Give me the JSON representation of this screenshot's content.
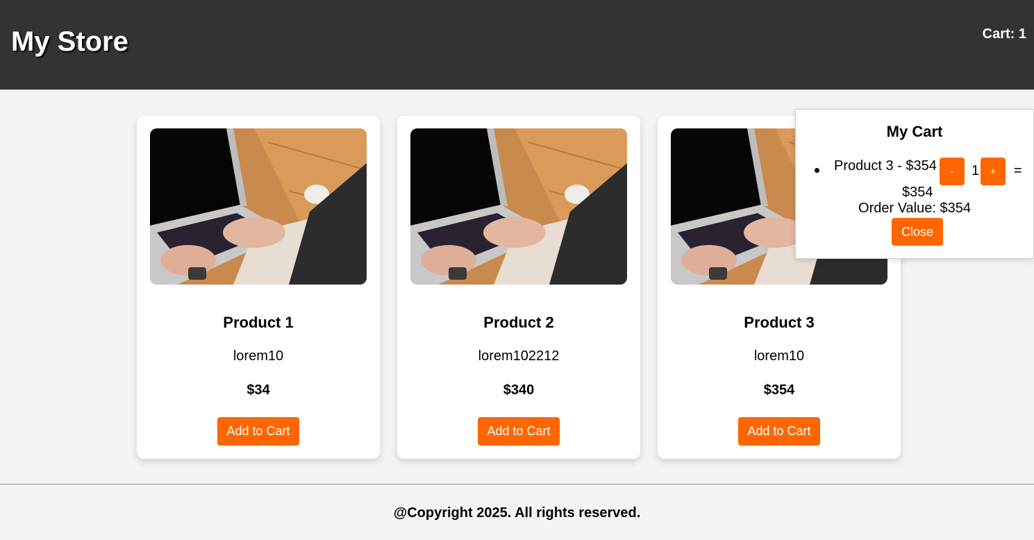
{
  "header": {
    "title": "My Store",
    "cart_label": "Cart: 1"
  },
  "products": [
    {
      "name": "Product 1",
      "description": "lorem10",
      "price": "$34",
      "button_label": "Add to Cart",
      "image_icon": "laptop-typing-photo"
    },
    {
      "name": "Product 2",
      "description": "lorem102212",
      "price": "$340",
      "button_label": "Add to Cart",
      "image_icon": "laptop-typing-photo"
    },
    {
      "name": "Product 3",
      "description": "lorem10",
      "price": "$354",
      "button_label": "Add to Cart",
      "image_icon": "laptop-typing-photo"
    }
  ],
  "cart": {
    "title": "My Cart",
    "items": [
      {
        "label": "Product 3 - $354",
        "decrement_label": "-",
        "quantity": "1",
        "increment_label": "+",
        "equals": "=",
        "subtotal": "$354"
      }
    ],
    "order_value": "Order Value: $354",
    "close_label": "Close"
  },
  "footer": {
    "copyright": "@Copyright 2025. All rights reserved."
  },
  "colors": {
    "header_bg": "#333333",
    "accent": "#ff6600",
    "page_bg": "#f4f4f4"
  }
}
